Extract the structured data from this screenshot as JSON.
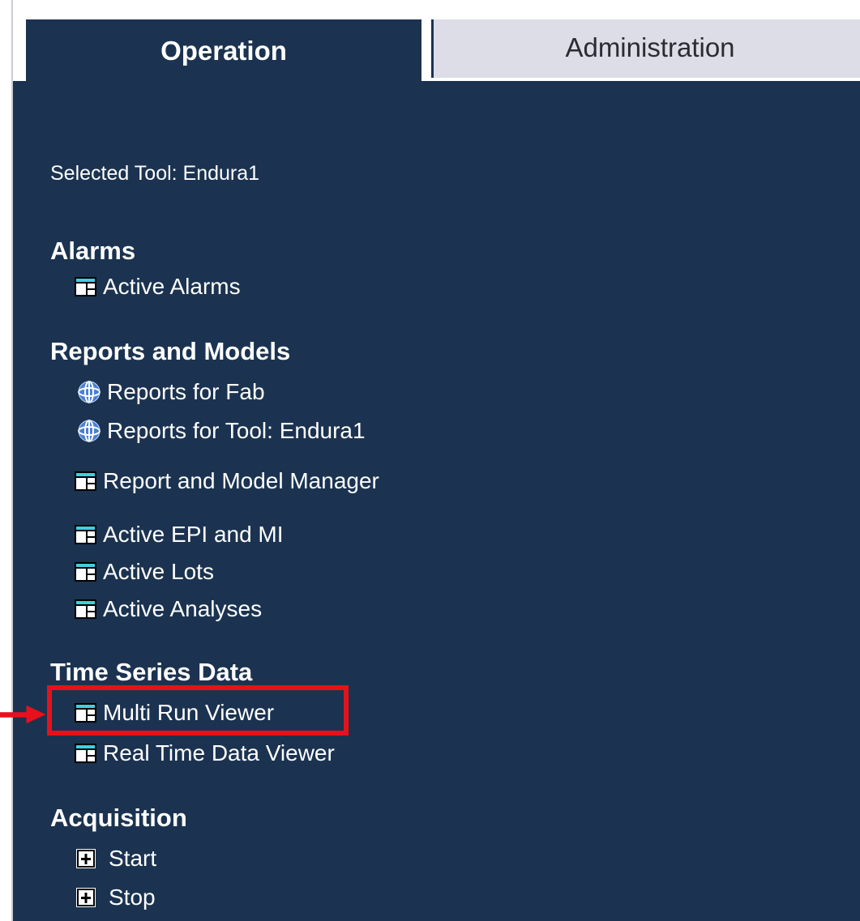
{
  "tabs": {
    "operation": "Operation",
    "administration": "Administration"
  },
  "selected_tool": "Selected Tool: Endura1",
  "sections": {
    "alarms": {
      "title": "Alarms",
      "items": [
        {
          "label": "Active Alarms",
          "icon": "table-icon"
        }
      ]
    },
    "reports": {
      "title": "Reports and Models",
      "items": [
        {
          "label": "Reports for Fab",
          "icon": "globe-icon"
        },
        {
          "label": "Reports for Tool: Endura1",
          "icon": "globe-icon"
        },
        {
          "label": "Report and Model Manager",
          "icon": "table-icon"
        },
        {
          "label": "Active EPI and MI",
          "icon": "table-icon"
        },
        {
          "label": "Active Lots",
          "icon": "table-icon"
        },
        {
          "label": "Active Analyses",
          "icon": "table-icon"
        }
      ]
    },
    "timeseries": {
      "title": "Time Series Data",
      "items": [
        {
          "label": "Multi Run Viewer",
          "icon": "table-icon",
          "highlighted": true
        },
        {
          "label": "Real Time Data Viewer",
          "icon": "table-icon"
        }
      ]
    },
    "acquisition": {
      "title": "Acquisition",
      "items": [
        {
          "label": "Start",
          "icon": "plus-icon"
        },
        {
          "label": "Stop",
          "icon": "plus-icon"
        }
      ]
    }
  },
  "colors": {
    "panel_bg": "#1b3350",
    "tab_inactive_bg": "#dcdde7",
    "highlight": "#e8111b",
    "icon_accent": "#3fd0e0"
  }
}
